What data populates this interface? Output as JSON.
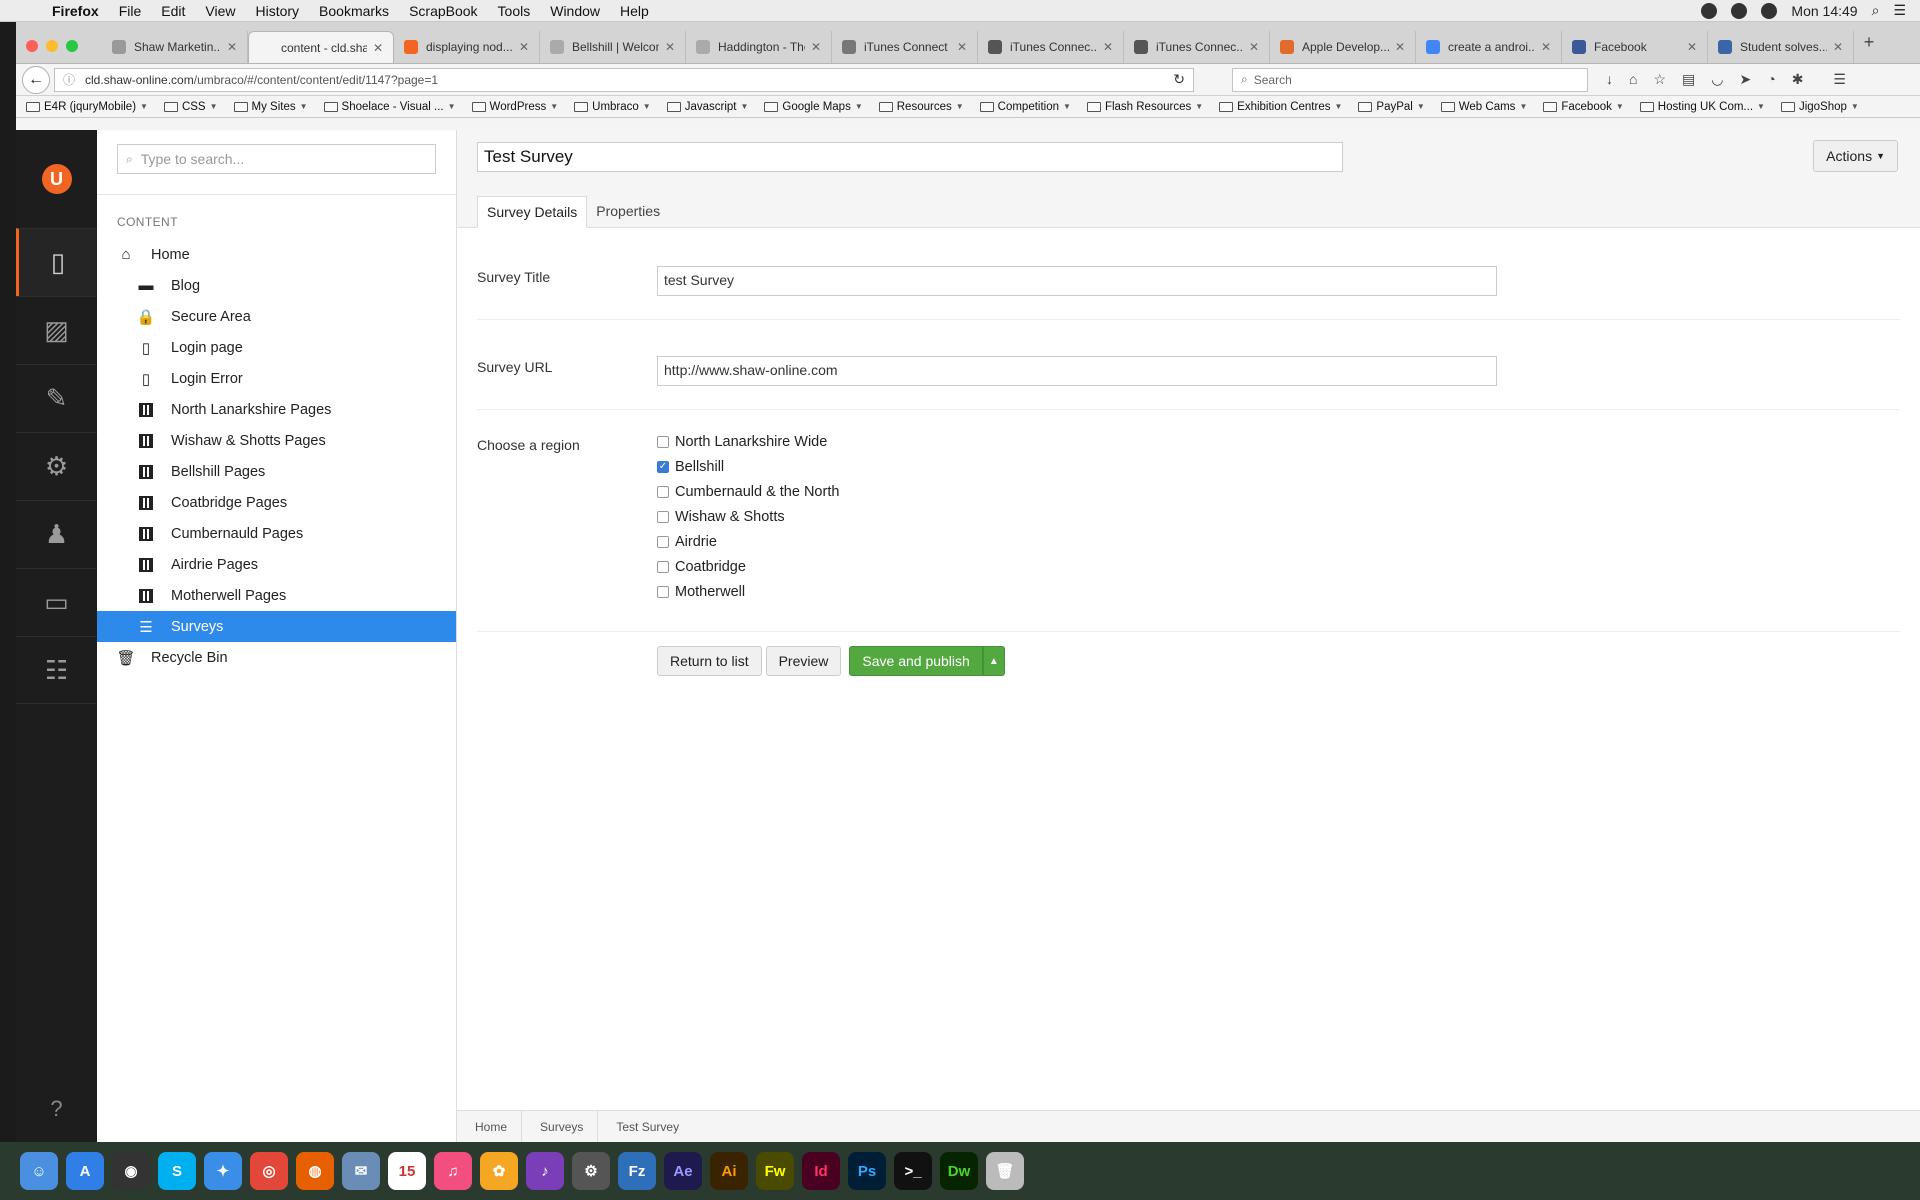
{
  "menubar": {
    "app": "Firefox",
    "items": [
      "File",
      "Edit",
      "View",
      "History",
      "Bookmarks",
      "ScrapBook",
      "Tools",
      "Window",
      "Help"
    ],
    "clock": "Mon 14:49"
  },
  "browser": {
    "tabs": [
      {
        "label": "Shaw Marketin...",
        "color": "#999"
      },
      {
        "label": "content - cld.shaw...",
        "color": "#f4f4f4",
        "active": true
      },
      {
        "label": "displaying nod...",
        "color": "#f26522"
      },
      {
        "label": "Bellshill | Welcome ...",
        "color": "#aaa"
      },
      {
        "label": "Haddington - The ...",
        "color": "#aaa"
      },
      {
        "label": "iTunes Connect",
        "color": "#777"
      },
      {
        "label": "iTunes Connec...",
        "color": "#555"
      },
      {
        "label": "iTunes Connec...",
        "color": "#555"
      },
      {
        "label": "Apple Develop...",
        "color": "#e06b2c"
      },
      {
        "label": "create a androi...",
        "color": "#4285f4"
      },
      {
        "label": "Facebook",
        "color": "#3b5998"
      },
      {
        "label": "Student solves...",
        "color": "#3a66a8"
      }
    ],
    "url_host": "cld.shaw-online.com",
    "url_path": "/umbraco/#/content/content/edit/1147?page=1",
    "search_placeholder": "Search",
    "bookmarks": [
      "E4R (jquryMobile)",
      "CSS",
      "My Sites",
      "Shoelace - Visual ...",
      "WordPress",
      "Umbraco",
      "Javascript",
      "Google Maps",
      "Resources",
      "Competition",
      "Flash Resources",
      "Exhibition Centres",
      "PayPal",
      "Web Cams",
      "Facebook",
      "Hosting UK Com...",
      "JigoShop"
    ]
  },
  "tree": {
    "search_placeholder": "Type to search...",
    "heading": "CONTENT",
    "nodes": [
      {
        "label": "Home",
        "level": 0,
        "icon": "home-icon"
      },
      {
        "label": "Blog",
        "level": 1,
        "icon": "folder-icon"
      },
      {
        "label": "Secure Area",
        "level": 1,
        "icon": "lock-icon"
      },
      {
        "label": "Login page",
        "level": 1,
        "icon": "document-icon"
      },
      {
        "label": "Login Error",
        "level": 1,
        "icon": "document-icon"
      },
      {
        "label": "North Lanarkshire Pages",
        "level": 1,
        "icon": "grid-icon"
      },
      {
        "label": "Wishaw & Shotts Pages",
        "level": 1,
        "icon": "grid-icon"
      },
      {
        "label": "Bellshill Pages",
        "level": 1,
        "icon": "grid-icon"
      },
      {
        "label": "Coatbridge Pages",
        "level": 1,
        "icon": "grid-icon"
      },
      {
        "label": "Cumbernauld Pages",
        "level": 1,
        "icon": "grid-icon"
      },
      {
        "label": "Airdrie Pages",
        "level": 1,
        "icon": "grid-icon"
      },
      {
        "label": "Motherwell Pages",
        "level": 1,
        "icon": "grid-icon"
      },
      {
        "label": "Surveys",
        "level": 1,
        "icon": "list-icon",
        "selected": true
      },
      {
        "label": "Recycle Bin",
        "level": 0,
        "icon": "trash-icon"
      }
    ]
  },
  "editor": {
    "node_name": "Test Survey",
    "actions_label": "Actions",
    "tabs": [
      "Survey Details",
      "Properties"
    ],
    "fields": {
      "title_label": "Survey Title",
      "title_value": "test Survey",
      "url_label": "Survey URL",
      "url_value": "http://www.shaw-online.com",
      "region_label": "Choose a region"
    },
    "regions": [
      {
        "label": "North Lanarkshire Wide",
        "checked": false
      },
      {
        "label": "Bellshill",
        "checked": true
      },
      {
        "label": "Cumbernauld & the North",
        "checked": false
      },
      {
        "label": "Wishaw & Shotts",
        "checked": false
      },
      {
        "label": "Airdrie",
        "checked": false
      },
      {
        "label": "Coatbridge",
        "checked": false
      },
      {
        "label": "Motherwell",
        "checked": false
      }
    ],
    "buttons": {
      "return": "Return to list",
      "preview": "Preview",
      "publish": "Save and publish"
    },
    "breadcrumbs": [
      "Home",
      "Surveys",
      "Test Survey"
    ]
  },
  "colors": {
    "accent_orange": "#f26522",
    "selected_blue": "#2e8aea",
    "publish_green": "#53a93f"
  }
}
